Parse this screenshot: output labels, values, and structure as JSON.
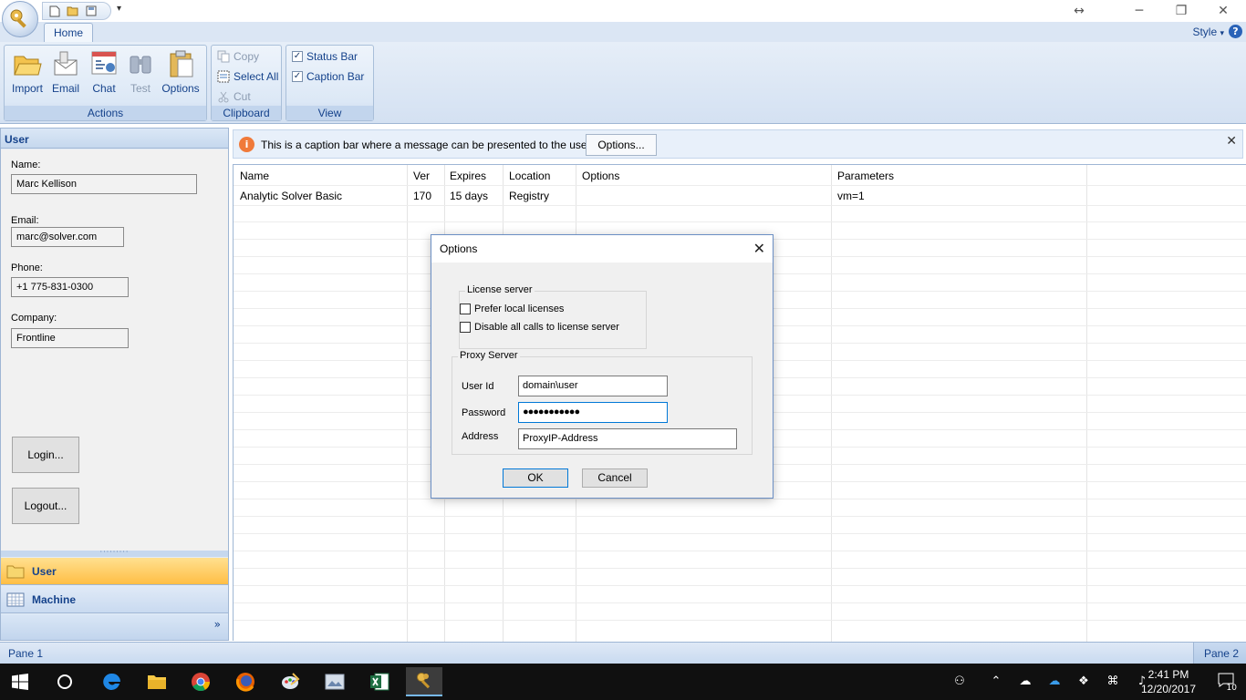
{
  "window": {
    "style_label": "Style",
    "help_label": "?"
  },
  "ribbon": {
    "tabs": [
      {
        "label": "Home"
      }
    ],
    "groups": {
      "actions": {
        "label": "Actions",
        "buttons": [
          {
            "label": "Import",
            "icon": "folder-open-icon"
          },
          {
            "label": "Email",
            "icon": "email-icon"
          },
          {
            "label": "Chat",
            "icon": "chat-icon"
          },
          {
            "label": "Test",
            "icon": "binoculars-icon",
            "disabled": true
          },
          {
            "label": "Options",
            "icon": "clipboard-icon"
          }
        ]
      },
      "clipboard": {
        "label": "Clipboard",
        "buttons": [
          {
            "label": "Copy",
            "disabled": true
          },
          {
            "label": "Select All",
            "disabled": false
          },
          {
            "label": "Cut",
            "disabled": true
          }
        ]
      },
      "view": {
        "label": "View",
        "checks": [
          {
            "label": "Status Bar",
            "checked": true
          },
          {
            "label": "Caption Bar",
            "checked": true
          }
        ]
      }
    }
  },
  "left_pane": {
    "title": "User",
    "fields": [
      {
        "label": "Name:",
        "value": "Marc Kellison"
      },
      {
        "label": "Email:",
        "value": "marc@solver.com"
      },
      {
        "label": "Phone:",
        "value": "+1 775-831-0300"
      },
      {
        "label": "Company:",
        "value": "Frontline"
      }
    ],
    "buttons": {
      "login": "Login...",
      "logout": "Logout..."
    },
    "nav": [
      {
        "label": "User",
        "active": true
      },
      {
        "label": "Machine",
        "active": false
      }
    ],
    "overflow": "»"
  },
  "caption_bar": {
    "message": "This is a caption bar where a message can be presented to the user.",
    "button": "Options...",
    "info": "i"
  },
  "grid": {
    "columns": [
      "Name",
      "Ver",
      "Expires",
      "Location",
      "Options",
      "Parameters"
    ],
    "rows": [
      [
        "Analytic Solver Basic",
        "170",
        "15 days",
        "Registry",
        "",
        "vm=1"
      ]
    ]
  },
  "status_bar": {
    "pane1": "Pane 1",
    "pane2": "Pane 2"
  },
  "dialog": {
    "title": "Options",
    "license_group": "License server",
    "prefer_local": "Prefer local licenses",
    "disable_calls": "Disable all calls to license server",
    "proxy_group": "Proxy Server",
    "user_id_label": "User Id",
    "user_id_value": "domain\\user",
    "password_label": "Password",
    "password_value": "●●●●●●●●●●●",
    "address_label": "Address",
    "address_value": "ProxyIP-Address",
    "ok": "OK",
    "cancel": "Cancel"
  },
  "taskbar": {
    "time": "2:41 PM",
    "date": "12/20/2017",
    "notifications": "10"
  },
  "colors": {
    "ribbon_text": "#15428b",
    "active_nav": "#ffbe45",
    "taskbar": "#101010"
  }
}
